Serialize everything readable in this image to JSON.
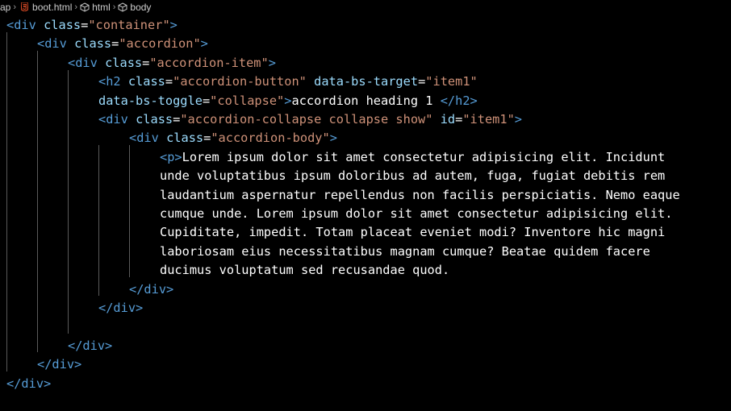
{
  "breadcrumb": {
    "items": [
      {
        "label": "ap"
      },
      {
        "label": "boot.html"
      },
      {
        "label": "html"
      },
      {
        "label": "body"
      }
    ],
    "separator": "›"
  },
  "colors": {
    "tag": "#569cd6",
    "attribute": "#9cdcfe",
    "string": "#ce9178",
    "text": "#ffffff",
    "html5_icon": "#e44d26",
    "background": "#000000"
  },
  "code": {
    "lines": [
      [
        {
          "t": "tag",
          "v": "<div "
        },
        {
          "t": "attr",
          "v": "class"
        },
        {
          "t": "txt",
          "v": "="
        },
        {
          "t": "str",
          "v": "\"container\""
        },
        {
          "t": "tag",
          "v": ">"
        }
      ],
      [
        {
          "t": "tag",
          "v": "<div "
        },
        {
          "t": "attr",
          "v": "class"
        },
        {
          "t": "txt",
          "v": "="
        },
        {
          "t": "str",
          "v": "\"accordion\""
        },
        {
          "t": "tag",
          "v": ">"
        }
      ],
      [
        {
          "t": "tag",
          "v": "<div "
        },
        {
          "t": "attr",
          "v": "class"
        },
        {
          "t": "txt",
          "v": "="
        },
        {
          "t": "str",
          "v": "\"accordion-item\""
        },
        {
          "t": "tag",
          "v": ">"
        }
      ],
      [
        {
          "t": "tag",
          "v": "<h2 "
        },
        {
          "t": "attr",
          "v": "class"
        },
        {
          "t": "txt",
          "v": "="
        },
        {
          "t": "str",
          "v": "\"accordion-button\""
        },
        {
          "t": "txt",
          "v": " "
        },
        {
          "t": "attr",
          "v": "data-bs-target"
        },
        {
          "t": "txt",
          "v": "="
        },
        {
          "t": "str",
          "v": "\"item1\""
        }
      ],
      [
        {
          "t": "attr",
          "v": "data-bs-toggle"
        },
        {
          "t": "txt",
          "v": "="
        },
        {
          "t": "str",
          "v": "\"collapse\""
        },
        {
          "t": "tag",
          "v": ">"
        },
        {
          "t": "txt",
          "v": "accordion heading 1 "
        },
        {
          "t": "tag",
          "v": "</h2>"
        }
      ],
      [
        {
          "t": "tag",
          "v": "<div "
        },
        {
          "t": "attr",
          "v": "class"
        },
        {
          "t": "txt",
          "v": "="
        },
        {
          "t": "str",
          "v": "\"accordion-collapse collapse show\""
        },
        {
          "t": "txt",
          "v": " "
        },
        {
          "t": "attr",
          "v": "id"
        },
        {
          "t": "txt",
          "v": "="
        },
        {
          "t": "str",
          "v": "\"item1\""
        },
        {
          "t": "tag",
          "v": ">"
        }
      ],
      [
        {
          "t": "tag",
          "v": "<div "
        },
        {
          "t": "attr",
          "v": "class"
        },
        {
          "t": "txt",
          "v": "="
        },
        {
          "t": "str",
          "v": "\"accordion-body\""
        },
        {
          "t": "tag",
          "v": ">"
        }
      ],
      [
        {
          "t": "tag",
          "v": "<p>"
        },
        {
          "t": "txt",
          "v": "Lorem ipsum dolor sit amet consectetur adipisicing elit. Incidunt"
        }
      ],
      [
        {
          "t": "txt",
          "v": "unde voluptatibus ipsum doloribus ad autem, fuga, fugiat debitis rem"
        }
      ],
      [
        {
          "t": "txt",
          "v": "laudantium aspernatur repellendus non facilis perspiciatis. Nemo eaque"
        }
      ],
      [
        {
          "t": "txt",
          "v": "cumque unde. Lorem ipsum dolor sit amet consectetur adipisicing elit."
        }
      ],
      [
        {
          "t": "txt",
          "v": "Cupiditate, impedit. Totam placeat eveniet modi? Inventore hic magni"
        }
      ],
      [
        {
          "t": "txt",
          "v": "laboriosam eius necessitatibus magnam cumque? Beatae quidem facere"
        }
      ],
      [
        {
          "t": "txt",
          "v": "ducimus voluptatum sed recusandae quod."
        }
      ],
      [
        {
          "t": "tag",
          "v": "</div>"
        }
      ],
      [
        {
          "t": "tag",
          "v": "</div>"
        }
      ],
      [],
      [
        {
          "t": "tag",
          "v": "</div>"
        }
      ],
      [
        {
          "t": "tag",
          "v": "</div>"
        }
      ],
      [
        {
          "t": "tag",
          "v": "</div>"
        }
      ]
    ]
  }
}
